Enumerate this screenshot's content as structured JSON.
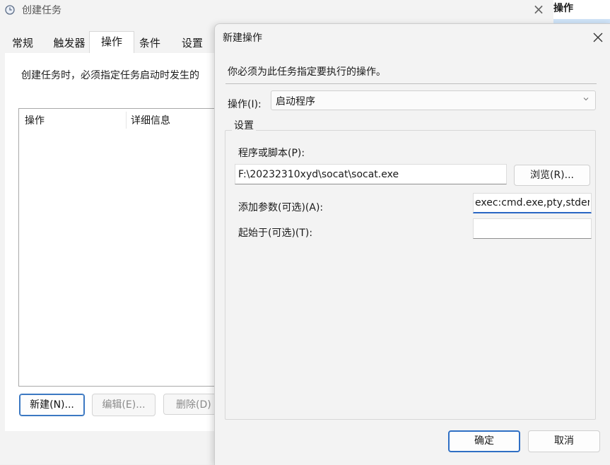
{
  "background_window": {
    "title": "创建任务",
    "right_panel_header": "操作",
    "tabs": [
      {
        "label": "常规"
      },
      {
        "label": "触发器"
      },
      {
        "label": "操作"
      },
      {
        "label": "条件"
      },
      {
        "label": "设置"
      }
    ],
    "active_tab": "操作",
    "instruction": "创建任务时，必须指定任务启动时发生的",
    "list_columns": [
      "操作",
      "详细信息"
    ],
    "buttons": {
      "new": "新建(N)...",
      "edit": "编辑(E)...",
      "delete": "删除(D)"
    }
  },
  "dialog": {
    "title": "新建操作",
    "subtitle": "你必须为此任务指定要执行的操作。",
    "action_label": "操作(I):",
    "action_value": "启动程序",
    "settings_legend": "设置",
    "program_label": "程序或脚本(P):",
    "program_value": "F:\\20232310xyd\\socat\\socat.exe",
    "browse_label": "浏览(R)...",
    "args_label": "添加参数(可选)(A):",
    "args_value": "exec:cmd.exe,pty,stderr",
    "startin_label": "起始于(可选)(T):",
    "startin_value": "",
    "ok_label": "确定",
    "cancel_label": "取消"
  },
  "icons": {
    "app": "clock-icon",
    "close": "close-icon",
    "dropdown": "chevron-down-icon"
  },
  "colors": {
    "accent": "#2f6fc4",
    "window_bg": "#f3f3f3"
  }
}
